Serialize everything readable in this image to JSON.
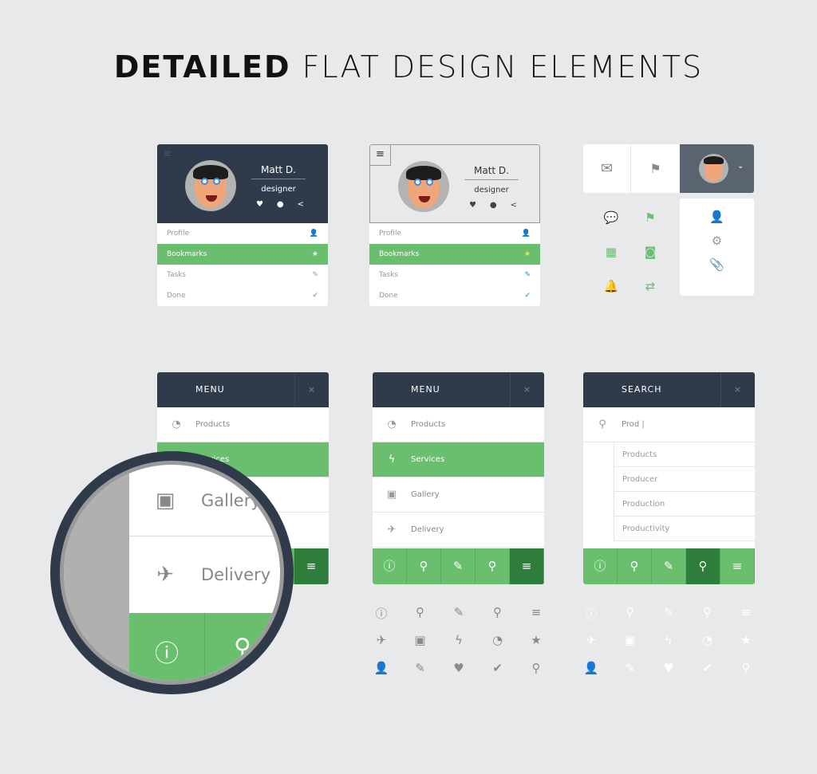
{
  "title": {
    "bold": "DETAILED",
    "light": "FLAT DESIGN ELEMENTS"
  },
  "profile": {
    "name": "Matt D.",
    "role": "designer",
    "items": [
      "Profile",
      "Bookmarks",
      "Tasks",
      "Done"
    ],
    "icons": [
      "user-icon",
      "star-icon",
      "pin-icon",
      "check-icon"
    ],
    "glyphs": [
      "👤",
      "★",
      "✎",
      "✔"
    ],
    "social": [
      "♥",
      "●",
      "<"
    ]
  },
  "menus": [
    {
      "title": "MENU",
      "close": "×",
      "items": [
        {
          "label": "Products",
          "icon": "◔"
        },
        {
          "label": "Services",
          "icon": "ϟ"
        },
        {
          "label": "Gallery",
          "icon": "▣"
        },
        {
          "label": "Delivery",
          "icon": "✈"
        }
      ],
      "active_item": 1,
      "active_footer": 4
    },
    {
      "title": "MENU",
      "close": "×",
      "items": [
        {
          "label": "Products",
          "icon": "◔"
        },
        {
          "label": "Services",
          "icon": "ϟ"
        },
        {
          "label": "Gallery",
          "icon": "▣"
        },
        {
          "label": "Delivery",
          "icon": "✈"
        }
      ],
      "active_item": 1,
      "active_footer": 4
    },
    {
      "title": "SEARCH",
      "close": "×",
      "search_value": "Prod |",
      "suggestions": [
        "Products",
        "Producer",
        "Production",
        "Productivity"
      ],
      "active_footer": 3
    }
  ],
  "footer_icons": [
    {
      "name": "info-icon",
      "g": "ⓘ"
    },
    {
      "name": "location-pin-icon",
      "g": "⚲"
    },
    {
      "name": "pencil-icon",
      "g": "✎"
    },
    {
      "name": "search-icon",
      "g": "⚲"
    },
    {
      "name": "menu-icon",
      "g": "≡"
    }
  ],
  "magnifier": {
    "rows": [
      "Gallery",
      "Delivery"
    ]
  },
  "icon_set": [
    "ⓘ",
    "⚲",
    "✎",
    "⚲",
    "≡",
    "✈",
    "▣",
    "ϟ",
    "◔",
    "★",
    "👤",
    "✎",
    "♥",
    "✔",
    "⚲"
  ],
  "colors": {
    "dark": "#2f3b4a",
    "green": "#6abf6f",
    "dark_green": "#2e7d3a",
    "bg": "#e8e9eb"
  }
}
